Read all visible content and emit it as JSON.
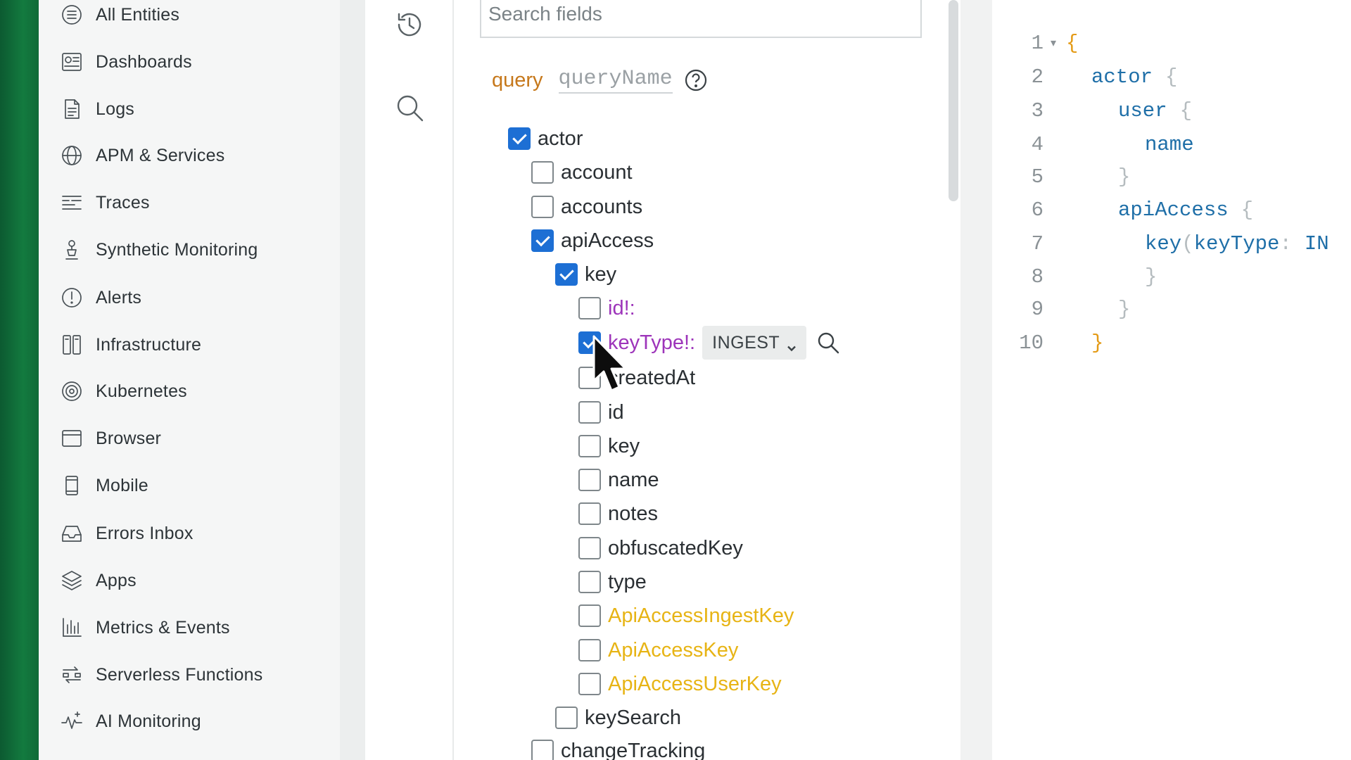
{
  "sidebar": {
    "items": [
      {
        "label": "All Entities",
        "icon": "entities-icon"
      },
      {
        "label": "Dashboards",
        "icon": "dashboards-icon"
      },
      {
        "label": "Logs",
        "icon": "logs-icon"
      },
      {
        "label": "APM & Services",
        "icon": "globe-icon"
      },
      {
        "label": "Traces",
        "icon": "traces-icon"
      },
      {
        "label": "Synthetic Monitoring",
        "icon": "synthetic-icon"
      },
      {
        "label": "Alerts",
        "icon": "alert-icon"
      },
      {
        "label": "Infrastructure",
        "icon": "infrastructure-icon"
      },
      {
        "label": "Kubernetes",
        "icon": "kubernetes-icon"
      },
      {
        "label": "Browser",
        "icon": "browser-icon"
      },
      {
        "label": "Mobile",
        "icon": "mobile-icon"
      },
      {
        "label": "Errors Inbox",
        "icon": "inbox-icon"
      },
      {
        "label": "Apps",
        "icon": "apps-icon"
      },
      {
        "label": "Metrics & Events",
        "icon": "metrics-icon"
      },
      {
        "label": "Serverless Functions",
        "icon": "serverless-icon"
      },
      {
        "label": "AI Monitoring",
        "icon": "ai-monitoring-icon"
      }
    ]
  },
  "tools": {
    "history_icon": "history-icon",
    "search_icon": "search-icon"
  },
  "explorer": {
    "search_placeholder": "Search fields",
    "query_keyword": "query",
    "query_name_placeholder": "queryName",
    "tree": [
      {
        "label": "actor",
        "checked": true,
        "kind": "field"
      },
      {
        "label": "account",
        "checked": false,
        "kind": "field"
      },
      {
        "label": "accounts",
        "checked": false,
        "kind": "field"
      },
      {
        "label": "apiAccess",
        "checked": true,
        "kind": "field"
      },
      {
        "label": "key",
        "checked": true,
        "kind": "field"
      },
      {
        "label": "id!:",
        "checked": false,
        "kind": "arg"
      },
      {
        "label": "keyType!:",
        "checked": true,
        "kind": "arg",
        "enum_value": "INGEST"
      },
      {
        "label": "createdAt",
        "checked": false,
        "kind": "field"
      },
      {
        "label": "id",
        "checked": false,
        "kind": "field"
      },
      {
        "label": "key",
        "checked": false,
        "kind": "field"
      },
      {
        "label": "name",
        "checked": false,
        "kind": "field"
      },
      {
        "label": "notes",
        "checked": false,
        "kind": "field"
      },
      {
        "label": "obfuscatedKey",
        "checked": false,
        "kind": "field"
      },
      {
        "label": "type",
        "checked": false,
        "kind": "field"
      },
      {
        "label": "ApiAccessIngestKey",
        "checked": false,
        "kind": "fragment"
      },
      {
        "label": "ApiAccessKey",
        "checked": false,
        "kind": "fragment"
      },
      {
        "label": "ApiAccessUserKey",
        "checked": false,
        "kind": "fragment"
      },
      {
        "label": "keySearch",
        "checked": false,
        "kind": "field"
      },
      {
        "label": "changeTracking",
        "checked": false,
        "kind": "field"
      }
    ]
  },
  "editor": {
    "lines": [
      {
        "n": "1",
        "fold": "▾",
        "text": "{"
      },
      {
        "n": "2",
        "text": "actor",
        "brace": "{"
      },
      {
        "n": "3",
        "text": "user",
        "brace": "{"
      },
      {
        "n": "4",
        "text": "name"
      },
      {
        "n": "5",
        "brace": "}"
      },
      {
        "n": "6",
        "text": "apiAccess",
        "brace": "{"
      },
      {
        "n": "7",
        "text": "key",
        "arg": "(keyType",
        "colon": ":",
        "value": "IN"
      },
      {
        "n": "8",
        "brace": "}"
      },
      {
        "n": "9",
        "brace": "}"
      },
      {
        "n": "10",
        "text": "}"
      }
    ]
  },
  "colors": {
    "brand_green": "#137a3f",
    "checkbox_blue": "#1d6fd4",
    "arg_purple": "#9d34ba",
    "fragment_yellow": "#e7b415",
    "keyword_orange": "#c6781b",
    "code_blue": "#1f6fa8"
  }
}
